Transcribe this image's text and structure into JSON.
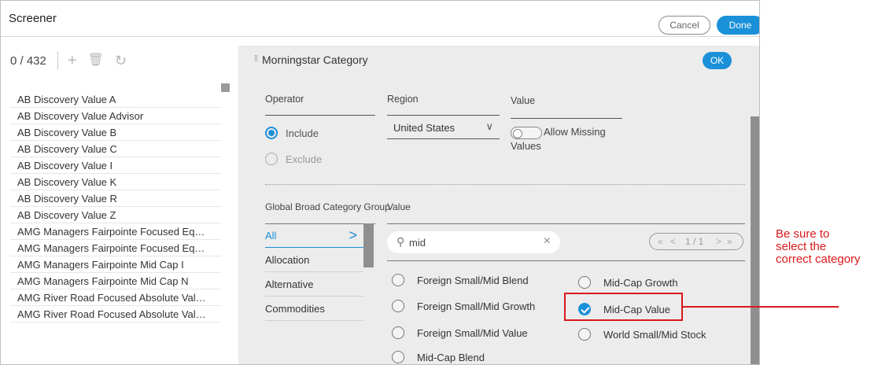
{
  "window": {
    "title": "Screener",
    "cancel_label": "Cancel",
    "done_label": "Done"
  },
  "left": {
    "count": "0 / 432",
    "funds": [
      "AB Discovery Value A",
      "AB Discovery Value Advisor",
      "AB Discovery Value B",
      "AB Discovery Value C",
      "AB Discovery Value I",
      "AB Discovery Value K",
      "AB Discovery Value R",
      "AB Discovery Value Z",
      "AMG Managers Fairpointe Focused Eq…",
      "AMG Managers Fairpointe Focused Eq…",
      "AMG Managers Fairpointe Mid Cap I",
      "AMG Managers Fairpointe Mid Cap N",
      "AMG River Road Focused Absolute Val…",
      "AMG River Road Focused Absolute Val…"
    ]
  },
  "panel": {
    "title": "Morningstar Category",
    "ok_label": "OK",
    "operator_label": "Operator",
    "region_label": "Region",
    "value_label": "Value",
    "include_label": "Include",
    "exclude_label": "Exclude",
    "region_value": "United States",
    "allow_missing_line1": "Allow Missing",
    "allow_missing_line2": "Values",
    "group_label": "Global Broad Category Group",
    "group_value_label": "Value",
    "categories": [
      "All",
      "Allocation",
      "Alternative",
      "Commodities"
    ],
    "search_query": "mid",
    "pager": "1 / 1",
    "options_col1": [
      "Foreign Small/Mid Blend",
      "Foreign Small/Mid Growth",
      "Foreign Small/Mid Value",
      "Mid-Cap Blend"
    ],
    "options_col2": [
      "Mid-Cap Growth",
      "Mid-Cap Value",
      "World Small/Mid Stock"
    ]
  },
  "callout": {
    "line1": "Be sure to",
    "line2": "select the",
    "line3": "correct category"
  },
  "colors": {
    "accent": "#1a90d9",
    "callout": "#d9191c"
  }
}
